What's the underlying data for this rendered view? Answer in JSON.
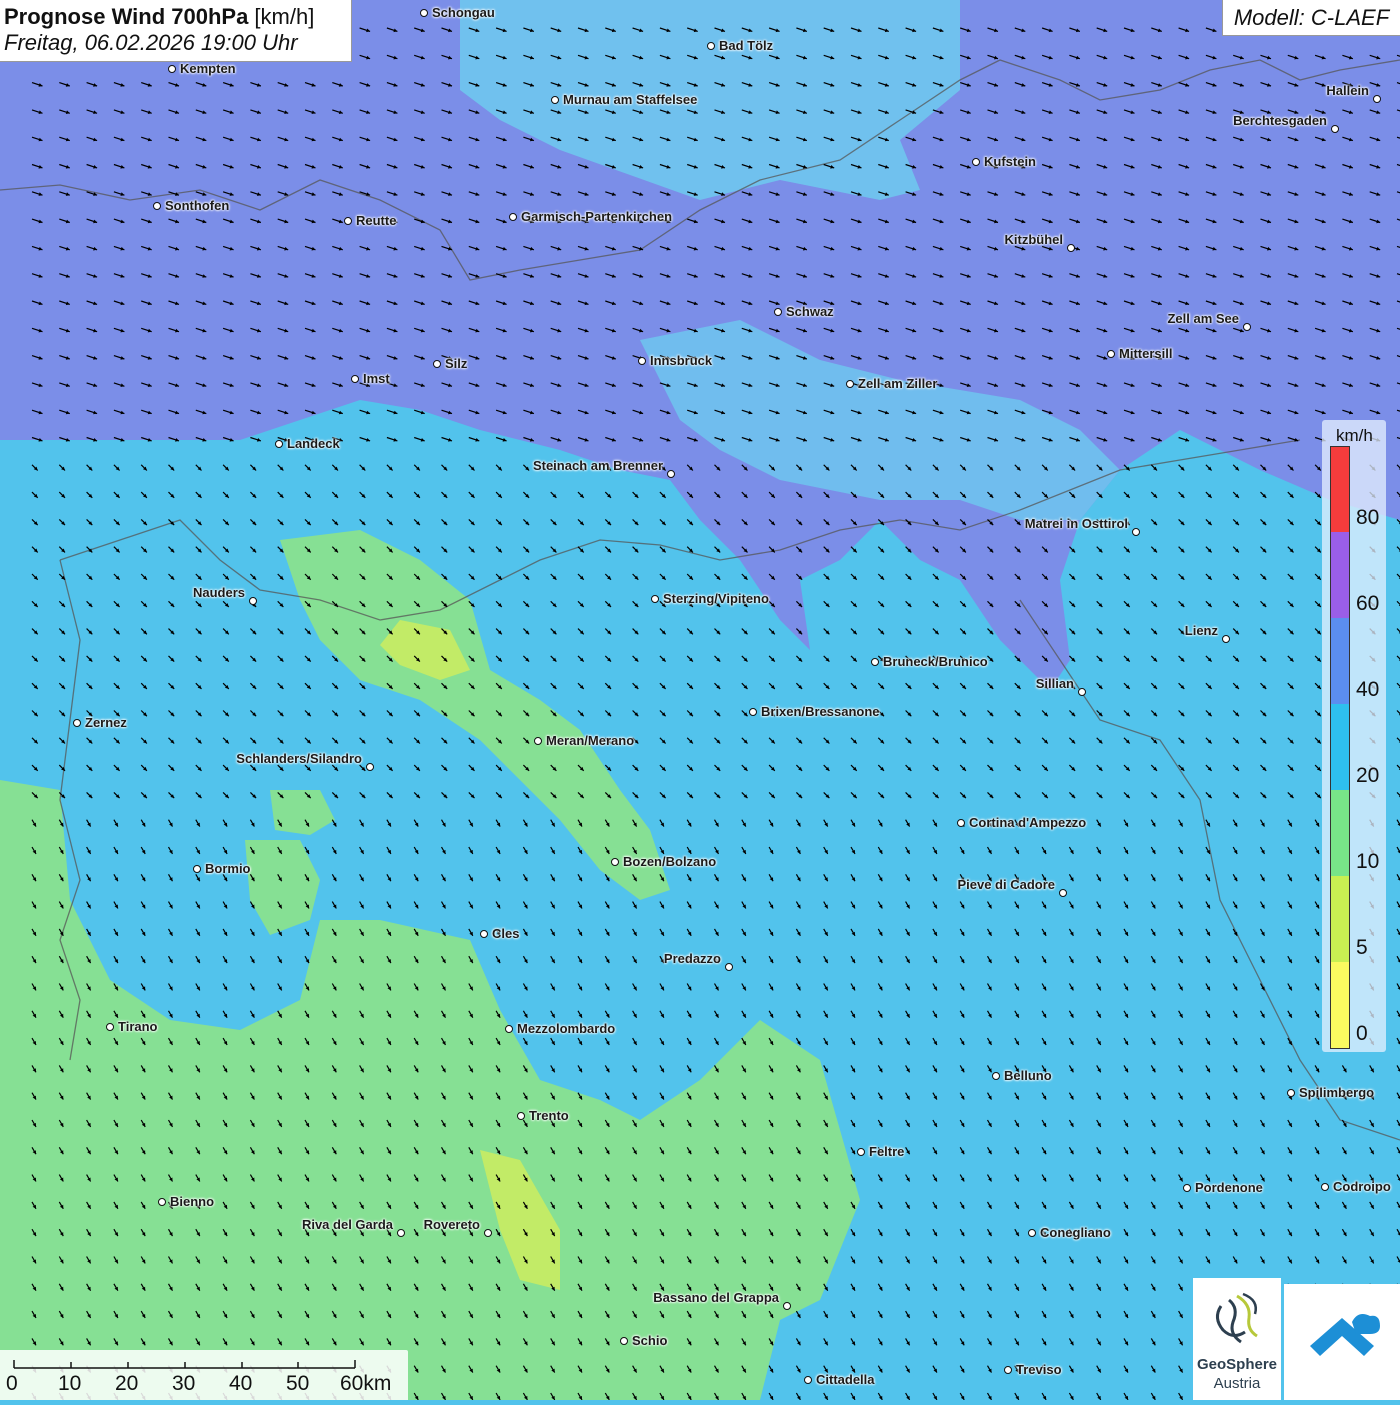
{
  "title": {
    "bold": "Prognose Wind 700hPa",
    "unit": " [km/h]",
    "datetime": "Freitag, 06.02.2026 19:00 Uhr"
  },
  "model": "Modell: C-LAEF",
  "legend": {
    "unit": "km/h",
    "bands": [
      {
        "label": "80",
        "color": "#f43c3c"
      },
      {
        "label": "60",
        "color": "#9a5ee8"
      },
      {
        "label": "40",
        "color": "#5b8ef0"
      },
      {
        "label": "20",
        "color": "#2ec0ee"
      },
      {
        "label": "10",
        "color": "#78e588"
      },
      {
        "label": "5",
        "color": "#c8f052"
      },
      {
        "label": "0",
        "color": "#fafa60"
      }
    ]
  },
  "scalebar": [
    "0",
    "10",
    "20",
    "30",
    "40",
    "50",
    "60km"
  ],
  "cities": [
    {
      "name": "Schongau"
    },
    {
      "name": "Bad Tölz"
    },
    {
      "name": "Kempten"
    },
    {
      "name": "Murnau am Staffelsee"
    },
    {
      "name": "Hallein"
    },
    {
      "name": "Berchtesgaden"
    },
    {
      "name": "Kufstein"
    },
    {
      "name": "Sonthofen"
    },
    {
      "name": "Reutte"
    },
    {
      "name": "Garmisch-Partenkirchen"
    },
    {
      "name": "Kitzbühel"
    },
    {
      "name": "Schwaz"
    },
    {
      "name": "Zell am See"
    },
    {
      "name": "Mittersill"
    },
    {
      "name": "Innsbruck"
    },
    {
      "name": "Silz"
    },
    {
      "name": "Imst"
    },
    {
      "name": "Zell am Ziller"
    },
    {
      "name": "Landeck"
    },
    {
      "name": "Steinach am Brenner"
    },
    {
      "name": "Matrei in Osttirol"
    },
    {
      "name": "Nauders"
    },
    {
      "name": "Sterzing/Vipiteno"
    },
    {
      "name": "Lienz"
    },
    {
      "name": "Bruneck/Brunico"
    },
    {
      "name": "Sillian"
    },
    {
      "name": "Brixen/Bressanone"
    },
    {
      "name": "Zernez"
    },
    {
      "name": "Meran/Merano"
    },
    {
      "name": "Schlanders/Silandro"
    },
    {
      "name": "Cortina d'Ampezzo"
    },
    {
      "name": "Bozen/Bolzano"
    },
    {
      "name": "Bormio"
    },
    {
      "name": "Pieve di Cadore"
    },
    {
      "name": "Cles"
    },
    {
      "name": "Predazzo"
    },
    {
      "name": "Tirano"
    },
    {
      "name": "Mezzolombardo"
    },
    {
      "name": "Belluno"
    },
    {
      "name": "Spilimbergo"
    },
    {
      "name": "Trento"
    },
    {
      "name": "Feltre"
    },
    {
      "name": "Pordenone"
    },
    {
      "name": "Codroipo"
    },
    {
      "name": "Bienno"
    },
    {
      "name": "Riva del Garda"
    },
    {
      "name": "Rovereto"
    },
    {
      "name": "Conegliano"
    },
    {
      "name": "Bassano del Grappa"
    },
    {
      "name": "Schio"
    },
    {
      "name": "Cittadella"
    },
    {
      "name": "Treviso"
    }
  ],
  "logos": {
    "geosphere_line1": "GeoSphere",
    "geosphere_line2": "Austria"
  }
}
